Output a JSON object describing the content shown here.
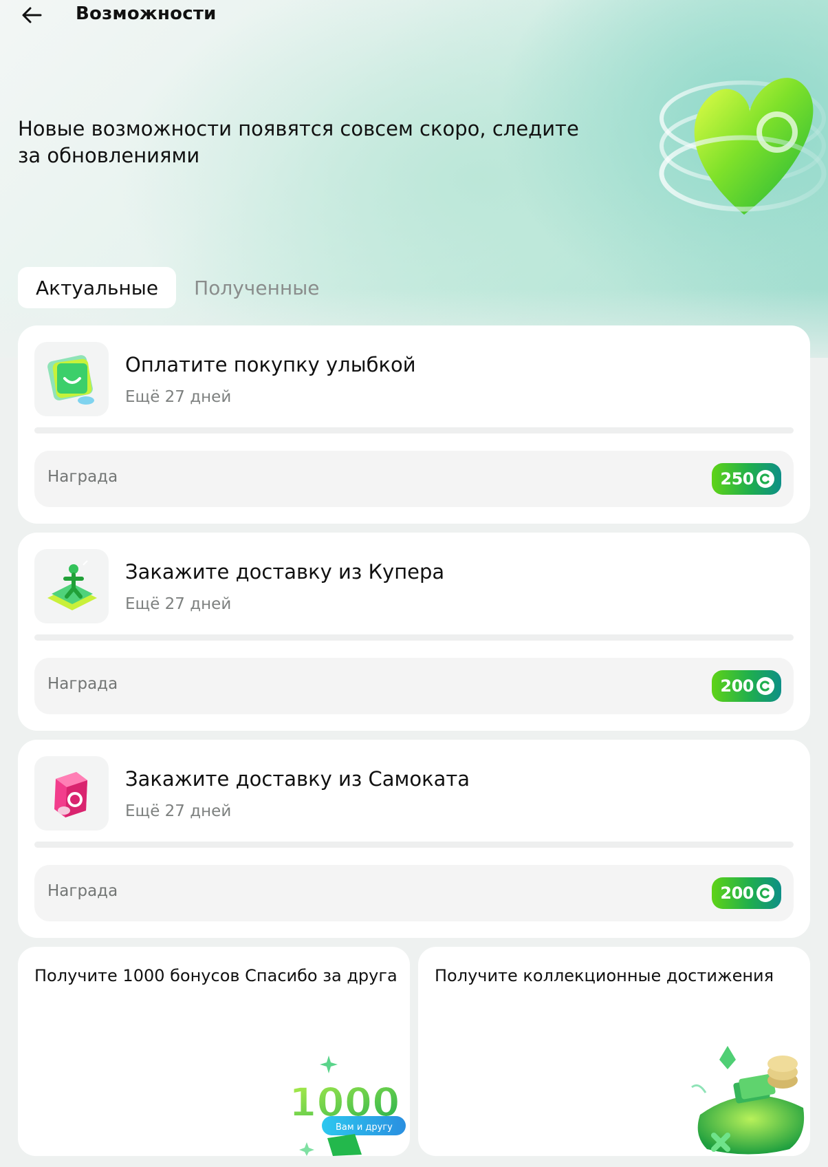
{
  "header": {
    "title": "Возможности",
    "back_icon": "arrow-left-icon"
  },
  "hero": {
    "text": "Новые возможности появятся совсем скоро, следите за обновлениями",
    "art_icon": "green-heart-coin-icon"
  },
  "tabs": [
    {
      "label": "Актуальные",
      "active": true
    },
    {
      "label": "Полученные",
      "active": false
    }
  ],
  "tasks": [
    {
      "title": "Оплатите покупку улыбкой",
      "subtitle": "Ещё 27 дней",
      "icon": "smile-payment-icon",
      "progress": 0,
      "reward_label": "Награда",
      "reward_value": "250"
    },
    {
      "title": "Закажите доставку из Купера",
      "subtitle": "Ещё 27 дней",
      "icon": "kuper-delivery-icon",
      "progress": 0,
      "reward_label": "Награда",
      "reward_value": "200"
    },
    {
      "title": "Закажите доставку из Самоката",
      "subtitle": "Ещё 27 дней",
      "icon": "samokat-delivery-icon",
      "progress": 0,
      "reward_label": "Награда",
      "reward_value": "200"
    }
  ],
  "promos": [
    {
      "title": "Получите 1000 бонусов Спасибо за друга",
      "art_icon": "bonus-1000-icon",
      "art_number": "1000",
      "art_caption": "Вам и другу"
    },
    {
      "title": "Получите коллекционные достижения",
      "art_icon": "achievements-pillow-icon"
    }
  ],
  "colors": {
    "accent_green": "#21a038",
    "badge_gradient_start": "#5fd317",
    "badge_gradient_end": "#0e8f86",
    "hero_teal": "#9fdcce"
  }
}
